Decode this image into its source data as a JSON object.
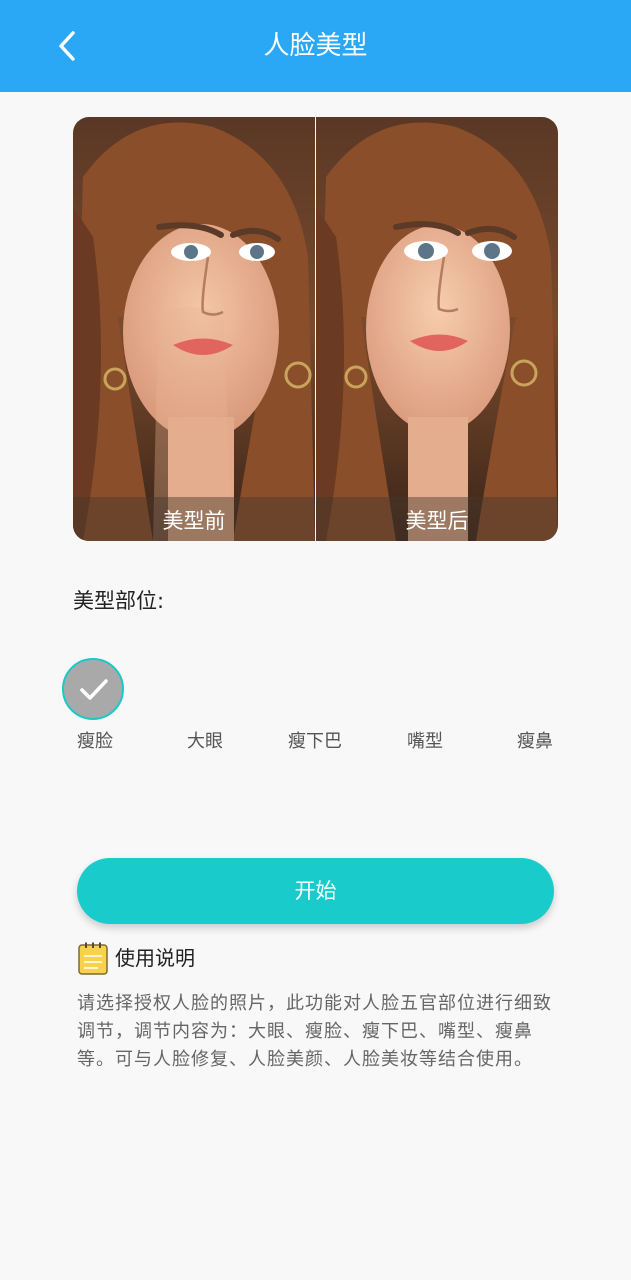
{
  "header": {
    "title": "人脸美型"
  },
  "compare": {
    "before_label": "美型前",
    "after_label": "美型后"
  },
  "parts": {
    "section_label": "美型部位:",
    "items": [
      {
        "label": "瘦脸",
        "selected": true
      },
      {
        "label": "大眼",
        "selected": false
      },
      {
        "label": "瘦下巴",
        "selected": false
      },
      {
        "label": "嘴型",
        "selected": false
      },
      {
        "label": "瘦鼻",
        "selected": false
      }
    ]
  },
  "actions": {
    "start_label": "开始"
  },
  "guide": {
    "icon": "notepad-icon",
    "title": "使用说明",
    "text": "请选择授权人脸的照片，此功能对人脸五官部位进行细致调节，调节内容为：大眼、瘦脸、瘦下巴、嘴型、瘦鼻等。可与人脸修复、人脸美颜、人脸美妆等结合使用。"
  },
  "colors": {
    "header": "#2aa7f5",
    "accent": "#19cccb",
    "selected_ring": "#18c9c9"
  }
}
